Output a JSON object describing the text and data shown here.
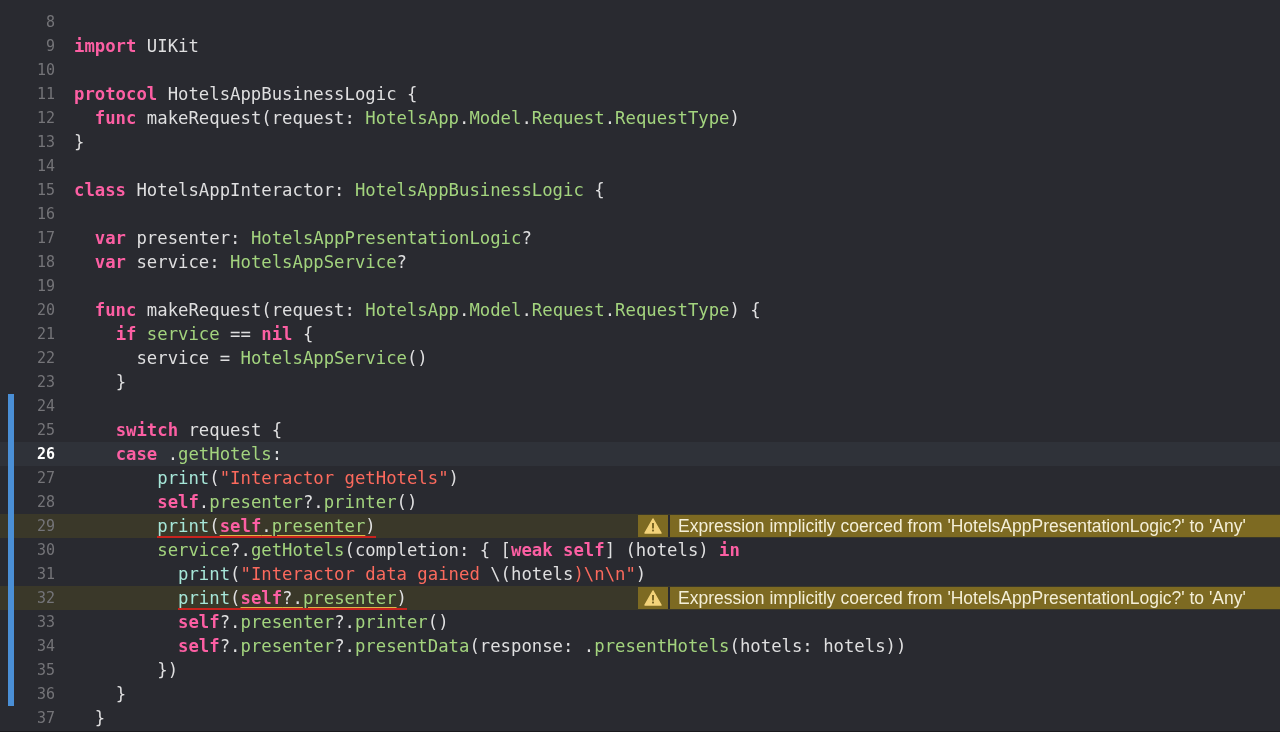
{
  "editor": {
    "lines": [
      {
        "number": "8",
        "current": false,
        "changed": false
      },
      {
        "number": "9",
        "current": false,
        "changed": false,
        "tokens": [
          {
            "text": "import",
            "kind": "kw"
          },
          {
            "text": " UIKit",
            "kind": "plain"
          }
        ]
      },
      {
        "number": "10",
        "current": false,
        "changed": false
      },
      {
        "number": "11",
        "current": false,
        "changed": false,
        "tokens": [
          {
            "text": "protocol",
            "kind": "kw"
          },
          {
            "text": " HotelsAppBusinessLogic {",
            "kind": "plain"
          }
        ]
      },
      {
        "number": "12",
        "current": false,
        "changed": false,
        "tokens": [
          {
            "text": "  func",
            "kind": "kw"
          },
          {
            "text": " makeRequest(request: ",
            "kind": "plain"
          },
          {
            "text": "HotelsApp",
            "kind": "proj"
          },
          {
            "text": ".",
            "kind": "plain"
          },
          {
            "text": "Model",
            "kind": "proj"
          },
          {
            "text": ".",
            "kind": "plain"
          },
          {
            "text": "Request",
            "kind": "proj"
          },
          {
            "text": ".",
            "kind": "plain"
          },
          {
            "text": "RequestType",
            "kind": "proj"
          },
          {
            "text": ")",
            "kind": "plain"
          }
        ]
      },
      {
        "number": "13",
        "current": false,
        "changed": false,
        "tokens": [
          {
            "text": "}",
            "kind": "plain"
          }
        ]
      },
      {
        "number": "14",
        "current": false,
        "changed": false
      },
      {
        "number": "15",
        "current": false,
        "changed": false,
        "tokens": [
          {
            "text": "class",
            "kind": "kw"
          },
          {
            "text": " HotelsAppInteractor: ",
            "kind": "plain"
          },
          {
            "text": "HotelsAppBusinessLogic",
            "kind": "proj"
          },
          {
            "text": " {",
            "kind": "plain"
          }
        ]
      },
      {
        "number": "16",
        "current": false,
        "changed": false
      },
      {
        "number": "17",
        "current": false,
        "changed": false,
        "tokens": [
          {
            "text": "  var",
            "kind": "kw"
          },
          {
            "text": " presenter: ",
            "kind": "plain"
          },
          {
            "text": "HotelsAppPresentationLogic",
            "kind": "proj"
          },
          {
            "text": "?",
            "kind": "plain"
          }
        ]
      },
      {
        "number": "18",
        "current": false,
        "changed": false,
        "tokens": [
          {
            "text": "  var",
            "kind": "kw"
          },
          {
            "text": " service: ",
            "kind": "plain"
          },
          {
            "text": "HotelsAppService",
            "kind": "proj"
          },
          {
            "text": "?",
            "kind": "plain"
          }
        ]
      },
      {
        "number": "19",
        "current": false,
        "changed": false
      },
      {
        "number": "20",
        "current": false,
        "changed": false,
        "tokens": [
          {
            "text": "  func",
            "kind": "kw"
          },
          {
            "text": " makeRequest(request: ",
            "kind": "plain"
          },
          {
            "text": "HotelsApp",
            "kind": "proj"
          },
          {
            "text": ".",
            "kind": "plain"
          },
          {
            "text": "Model",
            "kind": "proj"
          },
          {
            "text": ".",
            "kind": "plain"
          },
          {
            "text": "Request",
            "kind": "proj"
          },
          {
            "text": ".",
            "kind": "plain"
          },
          {
            "text": "RequestType",
            "kind": "proj"
          },
          {
            "text": ") {",
            "kind": "plain"
          }
        ]
      },
      {
        "number": "21",
        "current": false,
        "changed": false,
        "tokens": [
          {
            "text": "    if",
            "kind": "kw"
          },
          {
            "text": " service",
            "kind": "proj"
          },
          {
            "text": " == ",
            "kind": "plain"
          },
          {
            "text": "nil",
            "kind": "kw"
          },
          {
            "text": " {",
            "kind": "plain"
          }
        ]
      },
      {
        "number": "22",
        "current": false,
        "changed": false,
        "tokens": [
          {
            "text": "      service = ",
            "kind": "plain"
          },
          {
            "text": "HotelsAppService",
            "kind": "proj"
          },
          {
            "text": "()",
            "kind": "plain"
          }
        ]
      },
      {
        "number": "23",
        "current": false,
        "changed": false,
        "tokens": [
          {
            "text": "    }",
            "kind": "plain"
          }
        ]
      },
      {
        "number": "24",
        "current": false,
        "changed": true
      },
      {
        "number": "25",
        "current": false,
        "changed": true,
        "tokens": [
          {
            "text": "    switch",
            "kind": "kw"
          },
          {
            "text": " request {",
            "kind": "plain"
          }
        ]
      },
      {
        "number": "26",
        "current": true,
        "changed": true,
        "tokens": [
          {
            "text": "    case",
            "kind": "kw"
          },
          {
            "text": " .",
            "kind": "plain"
          },
          {
            "text": "getHotels",
            "kind": "proj"
          },
          {
            "text": ":",
            "kind": "plain"
          }
        ]
      },
      {
        "number": "27",
        "current": false,
        "changed": true,
        "tokens": [
          {
            "text": "        print",
            "kind": "sys"
          },
          {
            "text": "(",
            "kind": "plain"
          },
          {
            "text": "\"Interactor getHotels\"",
            "kind": "str"
          },
          {
            "text": ")",
            "kind": "plain"
          }
        ]
      },
      {
        "number": "28",
        "current": false,
        "changed": true,
        "tokens": [
          {
            "text": "        self",
            "kind": "kw"
          },
          {
            "text": ".",
            "kind": "plain"
          },
          {
            "text": "presenter",
            "kind": "proj"
          },
          {
            "text": "?.",
            "kind": "plain"
          },
          {
            "text": "printer",
            "kind": "proj"
          },
          {
            "text": "()",
            "kind": "plain"
          }
        ]
      },
      {
        "number": "29",
        "current": false,
        "changed": true,
        "warning": {
          "message": "Expression implicitly coerced from 'HotelsAppPresentationLogic?' to 'Any'"
        },
        "tokens": [
          {
            "text": "        print",
            "kind": "sys",
            "annotated": true
          },
          {
            "text": "(",
            "kind": "plain",
            "annotated": true
          },
          {
            "text": "self",
            "kind": "kw",
            "annotated": true,
            "flagged": true
          },
          {
            "text": ".",
            "kind": "plain",
            "annotated": true,
            "flagged": true
          },
          {
            "text": "presenter",
            "kind": "proj",
            "annotated": true,
            "flagged": true
          },
          {
            "text": ")",
            "kind": "plain",
            "annotated": true
          }
        ]
      },
      {
        "number": "30",
        "current": false,
        "changed": true,
        "tokens": [
          {
            "text": "        service",
            "kind": "proj"
          },
          {
            "text": "?.",
            "kind": "plain"
          },
          {
            "text": "getHotels",
            "kind": "proj"
          },
          {
            "text": "(completion: { [",
            "kind": "plain"
          },
          {
            "text": "weak",
            "kind": "kw"
          },
          {
            "text": " self",
            "kind": "kw"
          },
          {
            "text": "] (hotels) ",
            "kind": "plain"
          },
          {
            "text": "in",
            "kind": "kw"
          }
        ]
      },
      {
        "number": "31",
        "current": false,
        "changed": true,
        "tokens": [
          {
            "text": "          print",
            "kind": "sys"
          },
          {
            "text": "(",
            "kind": "plain"
          },
          {
            "text": "\"Interactor data gained ",
            "kind": "str"
          },
          {
            "text": "\\(hotels",
            "kind": "plain"
          },
          {
            "text": ")\\n\\n\"",
            "kind": "str"
          },
          {
            "text": ")",
            "kind": "plain"
          }
        ]
      },
      {
        "number": "32",
        "current": false,
        "changed": true,
        "warning": {
          "message": "Expression implicitly coerced from 'HotelsAppPresentationLogic?' to 'Any'"
        },
        "tokens": [
          {
            "text": "          print",
            "kind": "sys",
            "annotated": true
          },
          {
            "text": "(",
            "kind": "plain",
            "annotated": true
          },
          {
            "text": "self",
            "kind": "kw",
            "annotated": true,
            "flagged": true
          },
          {
            "text": "?.",
            "kind": "plain",
            "annotated": true,
            "flagged": true
          },
          {
            "text": "presenter",
            "kind": "proj",
            "annotated": true,
            "flagged": true
          },
          {
            "text": ")",
            "kind": "plain",
            "annotated": true
          }
        ]
      },
      {
        "number": "33",
        "current": false,
        "changed": true,
        "tokens": [
          {
            "text": "          self",
            "kind": "kw"
          },
          {
            "text": "?.",
            "kind": "plain"
          },
          {
            "text": "presenter",
            "kind": "proj"
          },
          {
            "text": "?.",
            "kind": "plain"
          },
          {
            "text": "printer",
            "kind": "proj"
          },
          {
            "text": "()",
            "kind": "plain"
          }
        ]
      },
      {
        "number": "34",
        "current": false,
        "changed": true,
        "tokens": [
          {
            "text": "          self",
            "kind": "kw"
          },
          {
            "text": "?.",
            "kind": "plain"
          },
          {
            "text": "presenter",
            "kind": "proj"
          },
          {
            "text": "?.",
            "kind": "plain"
          },
          {
            "text": "presentData",
            "kind": "proj"
          },
          {
            "text": "(response: .",
            "kind": "plain"
          },
          {
            "text": "presentHotels",
            "kind": "proj"
          },
          {
            "text": "(hotels: hotels))",
            "kind": "plain"
          }
        ]
      },
      {
        "number": "35",
        "current": false,
        "changed": true,
        "tokens": [
          {
            "text": "        })",
            "kind": "plain"
          }
        ]
      },
      {
        "number": "36",
        "current": false,
        "changed": true,
        "tokens": [
          {
            "text": "    }",
            "kind": "plain"
          }
        ]
      },
      {
        "number": "37",
        "current": false,
        "changed": false,
        "tokens": [
          {
            "text": "  }",
            "kind": "plain"
          }
        ]
      }
    ]
  }
}
